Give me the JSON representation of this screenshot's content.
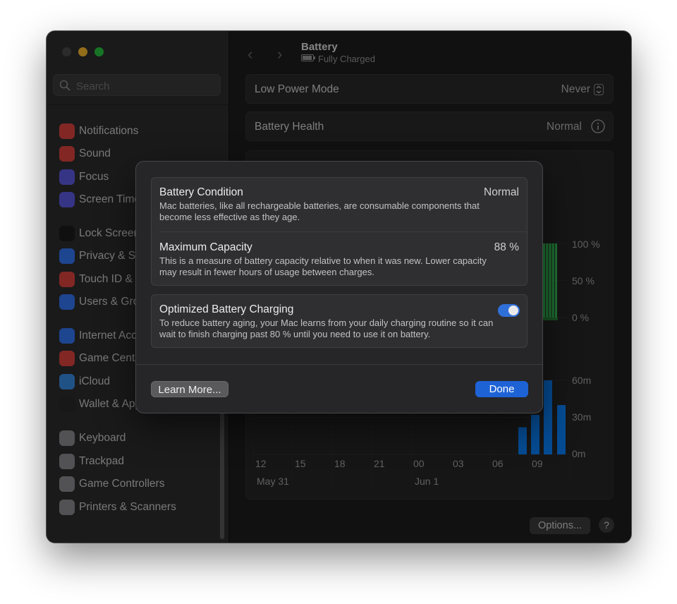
{
  "sidebar": {
    "search_placeholder": "Search",
    "items": [
      {
        "label": "Notifications",
        "icon": "bell-icon",
        "color": "#e0443e"
      },
      {
        "label": "Sound",
        "icon": "speaker-icon",
        "color": "#e0443e"
      },
      {
        "label": "Focus",
        "icon": "moon-icon",
        "color": "#5e5ce6"
      },
      {
        "label": "Screen Time",
        "icon": "hourglass-icon",
        "color": "#5e5ce6"
      },
      {
        "label": "Lock Screen",
        "icon": "lock-icon",
        "color": "#1c1c1e"
      },
      {
        "label": "Privacy & Security",
        "icon": "hand-icon",
        "color": "#3478f6"
      },
      {
        "label": "Touch ID & Password",
        "icon": "fingerprint-icon",
        "color": "#e0443e"
      },
      {
        "label": "Users & Groups",
        "icon": "users-icon",
        "color": "#3478f6"
      },
      {
        "label": "Internet Accounts",
        "icon": "at-icon",
        "color": "#3478f6"
      },
      {
        "label": "Game Center",
        "icon": "game-center-icon",
        "color": "#e0443e"
      },
      {
        "label": "iCloud",
        "icon": "cloud-icon",
        "color": "#3a8ee6"
      },
      {
        "label": "Wallet & Apple Pay",
        "icon": "wallet-icon",
        "color": "#2a2a2a"
      },
      {
        "label": "Keyboard",
        "icon": "keyboard-icon",
        "color": "#8e8e93"
      },
      {
        "label": "Trackpad",
        "icon": "trackpad-icon",
        "color": "#8e8e93"
      },
      {
        "label": "Game Controllers",
        "icon": "gamepad-icon",
        "color": "#8e8e93"
      },
      {
        "label": "Printers & Scanners",
        "icon": "printer-icon",
        "color": "#8e8e93"
      }
    ]
  },
  "header": {
    "title": "Battery",
    "subtitle": "Fully Charged"
  },
  "settings": {
    "low_power_label": "Low Power Mode",
    "low_power_value": "Never",
    "health_label": "Battery Health",
    "health_value": "Normal"
  },
  "chart_data": [
    {
      "type": "bar",
      "title": "",
      "y_ticks": [
        "100 %",
        "50 %",
        "0 %"
      ],
      "ylim": [
        0,
        100
      ],
      "series": [
        {
          "values": [
            100,
            100,
            100,
            100,
            100
          ]
        }
      ],
      "color": "#34c759"
    },
    {
      "type": "bar",
      "title": "",
      "categories": [
        "12",
        "15",
        "18",
        "21",
        "00",
        "03",
        "06",
        "09"
      ],
      "date_labels": [
        "May 31",
        "Jun 1"
      ],
      "y_ticks": [
        "60m",
        "30m",
        "0m"
      ],
      "ylim": [
        0,
        60
      ],
      "series": [
        {
          "values": [
            22,
            32,
            60,
            40
          ]
        }
      ],
      "color": "#0a84ff"
    }
  ],
  "modal": {
    "condition_title": "Battery Condition",
    "condition_value": "Normal",
    "condition_desc": "Mac batteries, like all rechargeable batteries, are consumable components that become less effective as they age.",
    "capacity_title": "Maximum Capacity",
    "capacity_value": "88 %",
    "capacity_desc": "This is a measure of battery capacity relative to when it was new. Lower capacity may result in fewer hours of usage between charges.",
    "optimized_title": "Optimized Battery Charging",
    "optimized_desc": "To reduce battery aging, your Mac learns from your daily charging routine so it can wait to finish charging past 80 % until you need to use it on battery.",
    "optimized_enabled": true,
    "learn_more": "Learn More...",
    "done": "Done"
  },
  "footer": {
    "options": "Options...",
    "help": "?"
  },
  "colors": {
    "accent": "#1e63d6",
    "toggle_on": "#2f6fd8"
  }
}
